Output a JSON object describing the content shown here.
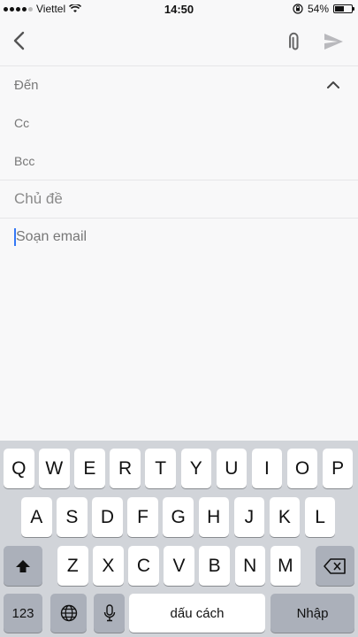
{
  "status_bar": {
    "carrier": "Viettel",
    "time": "14:50",
    "battery_text": "54%",
    "battery_level": 0.54
  },
  "toolbar": {
    "back_icon": "chevron-left-icon",
    "attach_icon": "paperclip-icon",
    "send_icon": "send-icon"
  },
  "compose": {
    "to_label": "Đến",
    "cc_label": "Cc",
    "bcc_label": "Bcc",
    "subject_placeholder": "Chủ đề",
    "body_placeholder": "Soạn email"
  },
  "keyboard": {
    "row1": [
      "Q",
      "W",
      "E",
      "R",
      "T",
      "Y",
      "U",
      "I",
      "O",
      "P"
    ],
    "row2": [
      "A",
      "S",
      "D",
      "F",
      "G",
      "H",
      "J",
      "K",
      "L"
    ],
    "row3": [
      "Z",
      "X",
      "C",
      "V",
      "B",
      "N",
      "M"
    ],
    "numbers_key": "123",
    "space_key": "dấu cách",
    "return_key": "Nhập",
    "shift_icon": "shift-icon",
    "delete_icon": "backspace-icon",
    "globe_icon": "globe-icon",
    "mic_icon": "microphone-icon"
  },
  "colors": {
    "accent": "#3478f6",
    "keyboard_bg": "#d1d4d9",
    "key_gray": "#abb0ba"
  }
}
